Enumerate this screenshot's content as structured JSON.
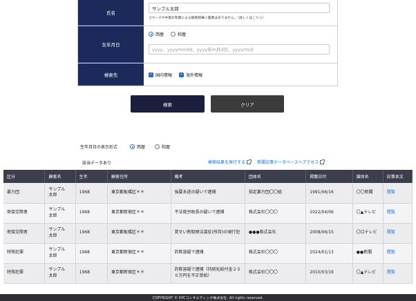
{
  "form": {
    "name_label": "氏名",
    "name_value": "サンプル太郎",
    "note_text": "スペースや中黒の有無による検索結果に差異はありません。（詳しくは",
    "note_link": "こちら",
    "note_tail": "）",
    "birth_label": "生年月日",
    "calendar_options": [
      "西暦",
      "和暦"
    ],
    "calendar_selected": "西暦",
    "birth_placeholder": "yyyy、yyyymmdd、yyyy年m月d日、yyyy/m/d",
    "search_target_label": "検索先",
    "search_targets": [
      "国内情報",
      "海外情報"
    ]
  },
  "buttons": {
    "search": "検索",
    "clear": "クリア"
  },
  "display_format": {
    "label": "生年月日の表示形式",
    "options": [
      "西暦",
      "和暦"
    ],
    "selected": "西暦"
  },
  "result_status": "該当データあり",
  "links": {
    "issue_results": "検索結果を発行する",
    "news_db": "新聞記事データベースへアクセス"
  },
  "table": {
    "columns": [
      "区分",
      "顧客名",
      "生年",
      "顧客住所",
      "備考",
      "団体名",
      "掲載日付",
      "媒体名",
      "記事本文"
    ],
    "rows": [
      [
        "暴力団",
        "サンプル\n太郎",
        "1968",
        "東京都板橋区＊＊",
        "強要未遂の疑いで逮捕",
        "指定暴力団〇〇組",
        "1991/06/16",
        "〇〇新聞",
        "閲覧"
      ],
      [
        "密接交際者",
        "サンプル\n太郎",
        "1968",
        "東京都新宿区＊＊",
        "不法就労助長の疑いで逮捕",
        "株式会社〇〇〇",
        "2022/04/06",
        "〇▲テレビ",
        "閲覧"
      ],
      [
        "密接交際者",
        "サンプル\n太郎",
        "1968",
        "東京都板橋区＊＊",
        "覚せい剤取締法違反(所持)の現行犯",
        "●●●株式会社",
        "2008/06/15",
        "〇ロテレビ",
        "閲覧"
      ],
      [
        "特殊犯罪",
        "サンプル\n太郎",
        "1968",
        "東京都新宿区＊＊",
        "詐欺容疑で逮捕",
        "株式会社〇〇〇",
        "2024/01/13",
        "●●新聞",
        "閲覧"
      ],
      [
        "特殊犯罪",
        "サンプル\n太郎",
        "1968",
        "東京都新宿区＊＊",
        "詐欺容疑で逮捕（持続化給付金２００万円を不正受給）",
        "株式会社〇〇〇",
        "2010/03/19",
        "〇▲テレビ",
        "閲覧"
      ]
    ]
  },
  "footer": "COPYRIGHT © KYCコンサルティング株式会社. All rights reserved."
}
